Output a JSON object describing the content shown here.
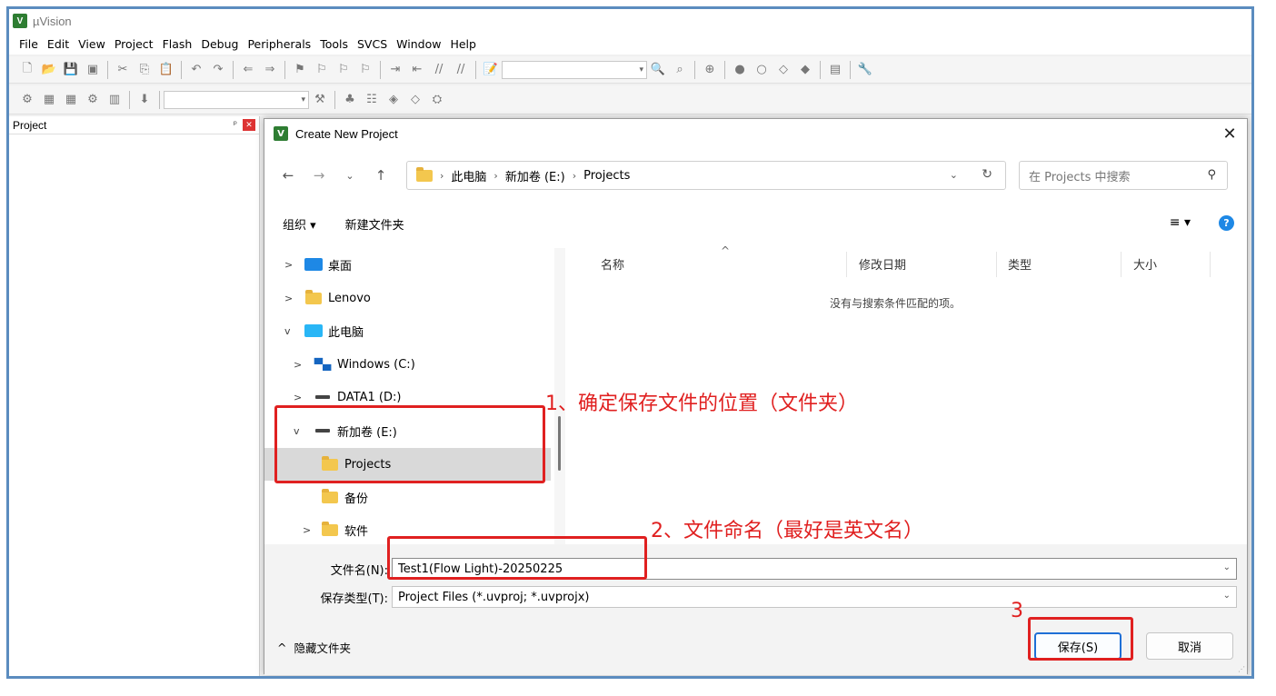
{
  "app": {
    "title": "µVision",
    "logo_text": "V"
  },
  "menu": [
    "File",
    "Edit",
    "View",
    "Project",
    "Flash",
    "Debug",
    "Peripherals",
    "Tools",
    "SVCS",
    "Window",
    "Help"
  ],
  "project_panel": {
    "title": "Project",
    "pin_icon": "pin-icon",
    "close_icon": "close-icon"
  },
  "dialog": {
    "title": "Create New Project",
    "close_glyph": "✕",
    "breadcrumb": [
      "此电脑",
      "新加卷 (E:)",
      "Projects"
    ],
    "search_placeholder": "在 Projects 中搜索",
    "commands": {
      "organize": "组织 ▾",
      "new_folder": "新建文件夹"
    },
    "nav_tree": [
      {
        "label": "桌面",
        "icon": "desktop-icon",
        "expander": ">"
      },
      {
        "label": "Lenovo",
        "icon": "folder-icon",
        "expander": ">"
      },
      {
        "label": "此电脑",
        "icon": "pc-icon",
        "expander": "v"
      },
      {
        "label": "Windows (C:)",
        "icon": "windows-drive-icon",
        "expander": ">"
      },
      {
        "label": "DATA1 (D:)",
        "icon": "drive-icon",
        "expander": ">"
      },
      {
        "label": "新加卷 (E:)",
        "icon": "drive-icon",
        "expander": "v"
      },
      {
        "label": "Projects",
        "icon": "folder-icon",
        "expander": "",
        "selected": true
      },
      {
        "label": "备份",
        "icon": "folder-icon",
        "expander": ""
      },
      {
        "label": "软件",
        "icon": "folder-icon",
        "expander": ">"
      }
    ],
    "columns": [
      "名称",
      "修改日期",
      "类型",
      "大小"
    ],
    "empty_message": "没有与搜索条件匹配的项。",
    "filename_label": "文件名(N):",
    "filename_value": "Test1(Flow Light)-20250225",
    "filetype_label": "保存类型(T):",
    "filetype_value": "Project Files (*.uvproj; *.uvprojx)",
    "hide_folders": "隐藏文件夹",
    "save_button": "保存(S)",
    "cancel_button": "取消"
  },
  "annotations": {
    "step1": "1、确定保存文件的位置（文件夹）",
    "step2": "2、文件命名（最好是英文名）",
    "step3": "3",
    "color": "#e02020"
  },
  "colors": {
    "frame_border": "#5b8cbf",
    "primary_button_border": "#1e6fd6",
    "help_icon": "#1e88e5"
  }
}
